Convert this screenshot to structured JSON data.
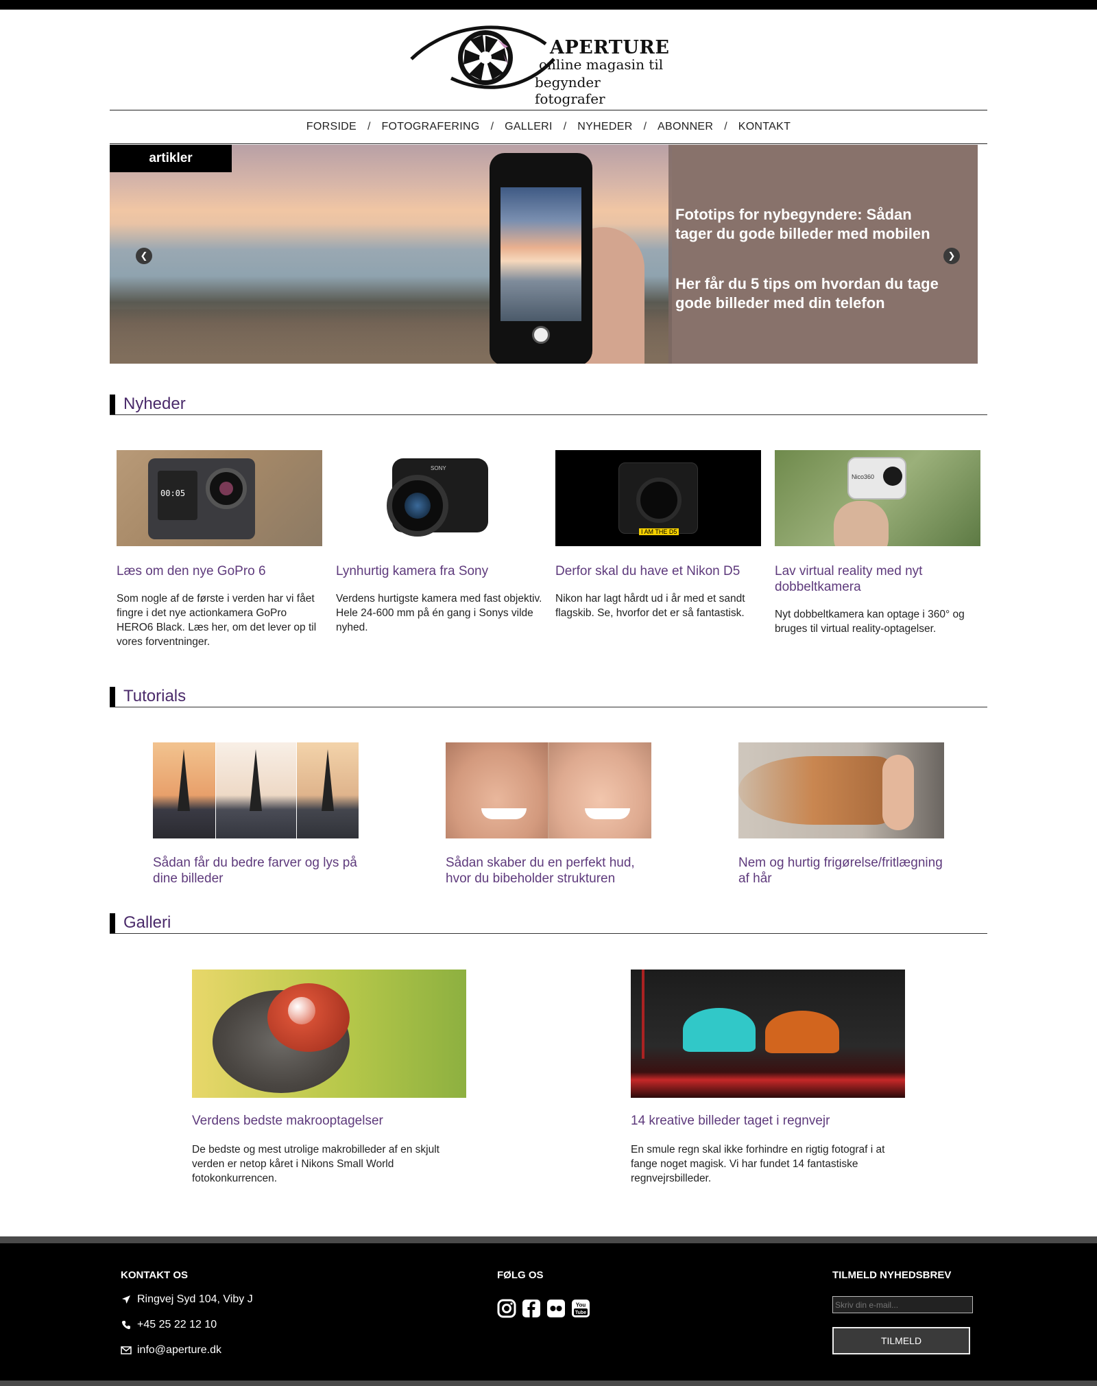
{
  "logo": {
    "title": "APERTURE",
    "subtitle_line1": "online magasin til",
    "subtitle_line2": "begynder fotografer"
  },
  "nav": {
    "items": [
      "FORSIDE",
      "FOTOGRAFERING",
      "GALLERI",
      "NYHEDER",
      "ABONNER",
      "KONTAKT"
    ],
    "separator": "/"
  },
  "slider": {
    "tag": "artikler",
    "title": "Fototips for nybegyndere: Sådan tager du gode billeder med mobilen",
    "text": "Her får du 5 tips om hvordan du tage gode billeder med din telefon",
    "prev_icon": "chevron-left-icon",
    "next_icon": "chevron-right-icon"
  },
  "sections": {
    "news": "Nyheder",
    "tutorials": "Tutorials",
    "gallery": "Galleri"
  },
  "news": [
    {
      "title": "Læs om den nye GoPro 6",
      "text": "Som nogle af de første i verden har vi fået fingre i det nye actionkamera GoPro HERO6 Black. Læs her, om det lever op til vores forventninger.",
      "badge": "00:05"
    },
    {
      "title": "Lynhurtig kamera fra Sony",
      "text": "Verdens hurtigste kamera med fast objektiv. Hele 24-600 mm på én gang i Sonys vilde nyhed.",
      "badge": "SONY"
    },
    {
      "title": "Derfor skal du have et Nikon D5",
      "text": "Nikon har lagt hårdt ud i år med et sandt flagskib. Se, hvorfor det er så fantastisk.",
      "badge": "I AM THE D5"
    },
    {
      "title": "Lav virtual reality med nyt dobbeltkamera",
      "text": "Nyt dobbeltkamera kan optage i 360° og bruges til virtual reality-optagelser.",
      "badge": "Nico360"
    }
  ],
  "tutorials": [
    {
      "title": "Sådan får du bedre farver og lys på dine billeder"
    },
    {
      "title": "Sådan skaber du en perfekt hud, hvor du bibeholder strukturen"
    },
    {
      "title": "Nem og hurtig frigørelse/fritlægning af hår"
    }
  ],
  "gallery": [
    {
      "title": "Verdens bedste makrooptagelser",
      "text": "De bedste og mest utrolige makrobilleder af en skjult verden er netop kåret i Nikons Small World fotokonkurrencen."
    },
    {
      "title": "14 kreative billeder taget i regnvejr",
      "text": "En smule regn skal ikke forhindre en rigtig fotograf i at fange noget magisk. Vi har fundet 14 fantastiske regnvejrsbilleder."
    }
  ],
  "footer": {
    "contact_head": "KONTAKT OS",
    "address": "Ringvej Syd 104, Viby J",
    "phone": "+45 25 22 12 10",
    "email": "info@aperture.dk",
    "follow_head": "FØLG OS",
    "social": [
      "instagram-icon",
      "facebook-icon",
      "flickr-icon",
      "youtube-icon"
    ],
    "youtube_you": "You",
    "youtube_tube": "Tube",
    "newsletter_head": "TILMELD NYHEDSBREV",
    "newsletter_placeholder": "Skriv din e-mail...",
    "newsletter_button": "TILMELD"
  },
  "colors": {
    "accent": "#5e3a7c",
    "footer": "#000000",
    "logo_pink": "#c98fbf"
  }
}
